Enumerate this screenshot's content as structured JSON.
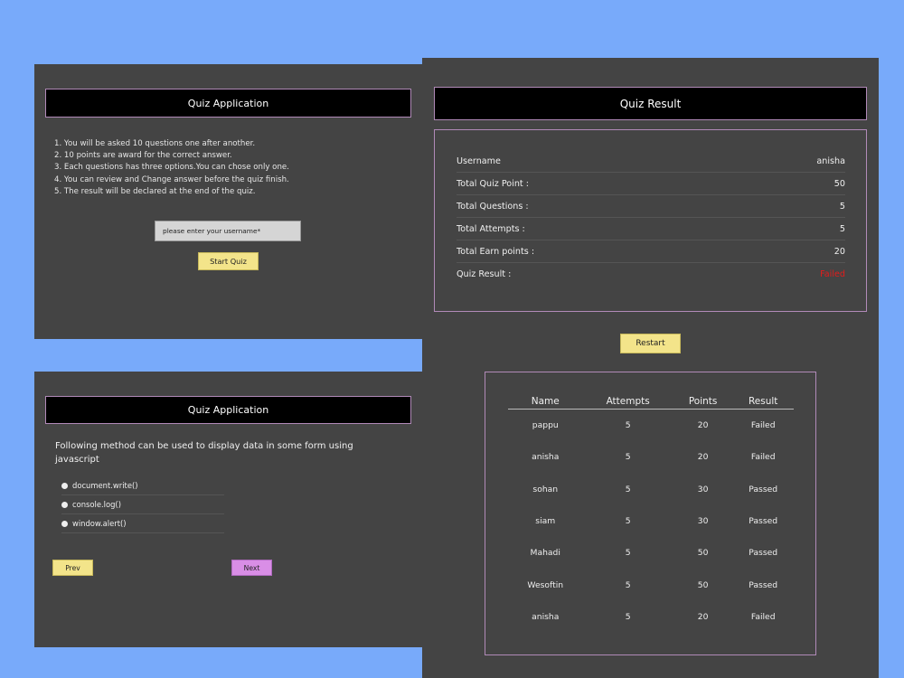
{
  "start_screen": {
    "title": "Quiz Application",
    "rules": [
      "1. You will be asked 10 questions one after another.",
      "2. 10 points are award for the correct answer.",
      "3. Each questions has three options.You can chose only one.",
      "4. You can review and Change answer before the quiz finish.",
      "5. The result will be declared at the end of the quiz."
    ],
    "username_placeholder": "please enter your username*",
    "start_label": "Start Quiz"
  },
  "question_screen": {
    "title": "Quiz Application",
    "question": "Following method can be used to display data in some form using javascript",
    "options": [
      "document.write()",
      "console.log()",
      "window.alert()"
    ],
    "prev_label": "Prev",
    "next_label": "Next"
  },
  "result_screen": {
    "title": "Quiz Result",
    "summary": [
      {
        "label": "Username",
        "value": "anisha"
      },
      {
        "label": "Total Quiz Point :",
        "value": "50"
      },
      {
        "label": "Total Questions :",
        "value": "5"
      },
      {
        "label": "Total Attempts :",
        "value": "5"
      },
      {
        "label": "Total Earn points :",
        "value": "20"
      },
      {
        "label": "Quiz Result :",
        "value": "Failed"
      }
    ],
    "restart_label": "Restart",
    "table": {
      "headers": [
        "Name",
        "Attempts",
        "Points",
        "Result"
      ],
      "rows": [
        [
          "pappu",
          "5",
          "20",
          "Failed"
        ],
        [
          "anisha",
          "5",
          "20",
          "Failed"
        ],
        [
          "sohan",
          "5",
          "30",
          "Passed"
        ],
        [
          "siam",
          "5",
          "30",
          "Passed"
        ],
        [
          "Mahadi",
          "5",
          "50",
          "Passed"
        ],
        [
          "Wesoftin",
          "5",
          "50",
          "Passed"
        ],
        [
          "anisha",
          "5",
          "20",
          "Failed"
        ]
      ]
    }
  },
  "colors": {
    "background": "#78aafa",
    "panel": "#444444",
    "accent_border": "#b18ab8",
    "button_yellow": "#f3e48a",
    "button_purple": "#d98ee6",
    "fail_red": "#e41b1b"
  }
}
